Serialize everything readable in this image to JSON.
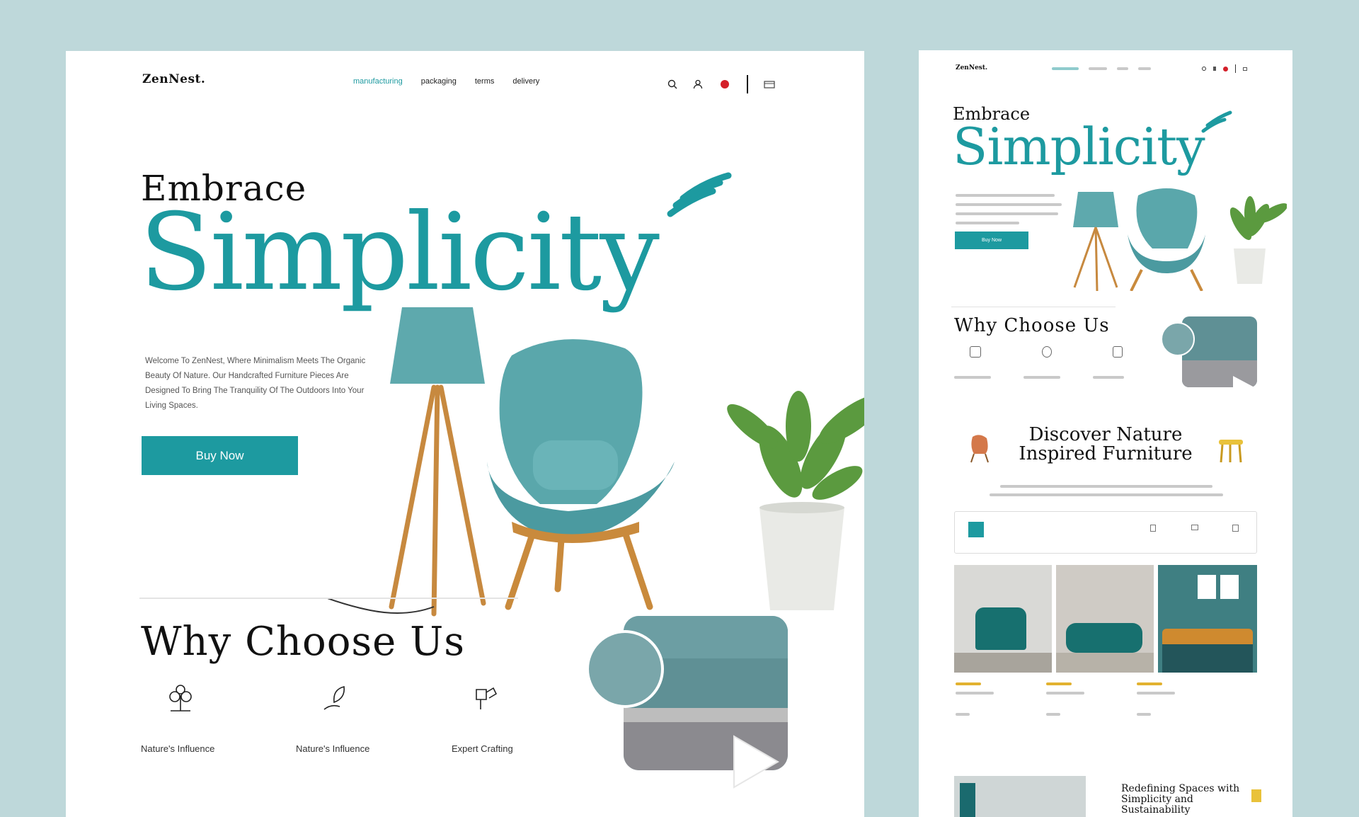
{
  "colors": {
    "background": "#bed8da",
    "accent": "#1d9aa0",
    "accent_dark": "#117b80",
    "badge": "#d4202a"
  },
  "main": {
    "logo": "ZenNest.",
    "nav": [
      {
        "label": "manufacturing",
        "active": true
      },
      {
        "label": "packaging",
        "active": false
      },
      {
        "label": "terms",
        "active": false
      },
      {
        "label": "delivery",
        "active": false
      }
    ],
    "header_icons": [
      "search-icon",
      "user-icon",
      "cart-icon",
      "menu-icon"
    ],
    "hero": {
      "kicker": "Embrace",
      "title": "Simplicity",
      "description": "Welcome To ZenNest, Where Minimalism Meets The Organic Beauty Of Nature. Our Handcrafted Furniture Pieces Are Designed To Bring The Tranquility Of The Outdoors Into Your Living Spaces.",
      "cta": "Buy Now"
    },
    "why": {
      "title": "Why Choose Us",
      "features": [
        {
          "icon": "plant-icon",
          "label": "Nature's Influence"
        },
        {
          "icon": "leaf-hand-icon",
          "label": "Nature's Influence"
        },
        {
          "icon": "craft-icon",
          "label": "Expert Crafting"
        }
      ],
      "video_icon": "play-icon"
    }
  },
  "side": {
    "logo": "ZenNest.",
    "hero": {
      "kicker": "Embrace",
      "title": "Simplicity",
      "cta": "Buy Now"
    },
    "why_title": "Why Choose Us",
    "discover_title_line1": "Discover Nature",
    "discover_title_line2": "Inspired Furniture"
  },
  "partial_text": {
    "redefining": "Redefining Spaces with Simplicity and Sustainability"
  }
}
